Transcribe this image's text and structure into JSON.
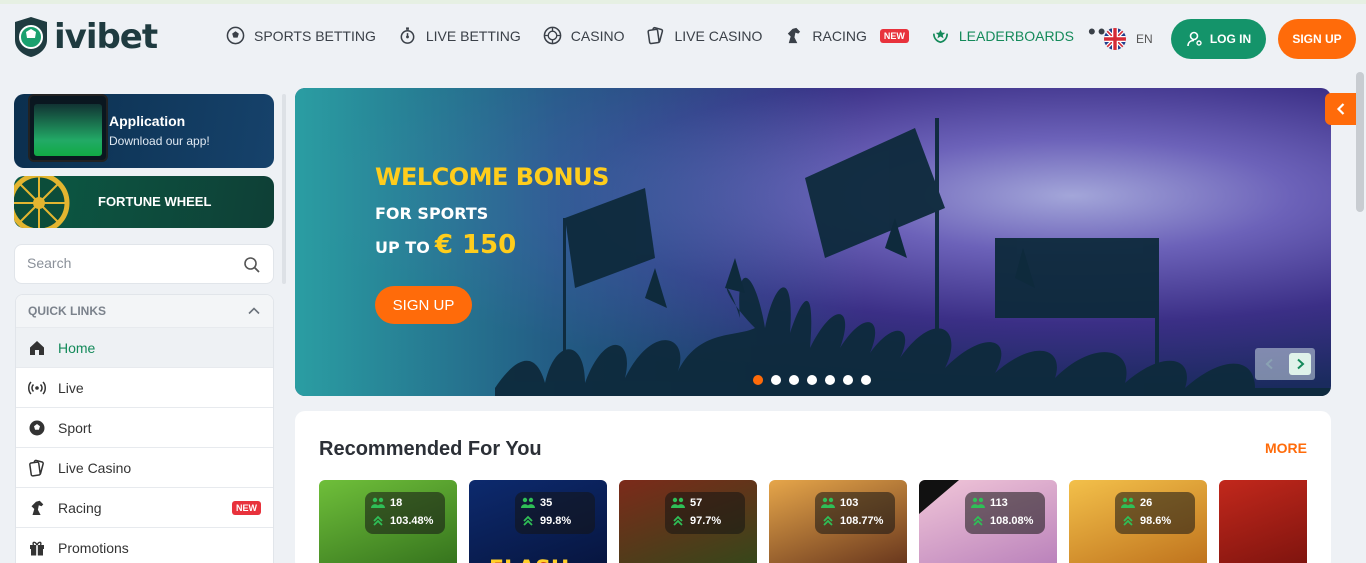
{
  "brand": {
    "name": "ivibet"
  },
  "nav": [
    {
      "label": "SPORTS BETTING",
      "icon": "soccer-ball-icon"
    },
    {
      "label": "LIVE BETTING",
      "icon": "stopwatch-icon"
    },
    {
      "label": "CASINO",
      "icon": "roulette-icon"
    },
    {
      "label": "LIVE CASINO",
      "icon": "cards-icon"
    },
    {
      "label": "RACING",
      "icon": "horse-icon",
      "badge": "NEW"
    },
    {
      "label": "LEADERBOARDS",
      "icon": "laurel-icon",
      "active": true
    }
  ],
  "header": {
    "lang": "EN",
    "login": "LOG IN",
    "signup": "SIGN UP"
  },
  "sidebar": {
    "app": {
      "title": "Application",
      "subtitle": "Download our app!"
    },
    "wheel": {
      "title": "FORTUNE WHEEL"
    },
    "search_placeholder": "Search",
    "quick_title": "QUICK LINKS",
    "items": [
      {
        "label": "Home",
        "icon": "home-icon"
      },
      {
        "label": "Live",
        "icon": "broadcast-icon"
      },
      {
        "label": "Sport",
        "icon": "soccer-ball-icon"
      },
      {
        "label": "Live Casino",
        "icon": "cards-icon"
      },
      {
        "label": "Racing",
        "icon": "horse-icon",
        "badge": "NEW"
      },
      {
        "label": "Promotions",
        "icon": "gift-icon"
      }
    ]
  },
  "banner": {
    "title": "WELCOME BONUS",
    "line1": "FOR SPORTS",
    "line2_prefix": "UP TO",
    "line2_amount": "€ 150",
    "cta": "SIGN UP",
    "slide_count": 7,
    "active_slide": 0
  },
  "recommended": {
    "title": "Recommended For You",
    "more": "MORE",
    "games": [
      {
        "players": "18",
        "rtp": "103.48%",
        "colors": [
          "#6fbf3a",
          "#2f6b1a"
        ]
      },
      {
        "players": "35",
        "rtp": "99.8%",
        "colors": [
          "#0d2a6e",
          "#06133a"
        ],
        "label": "FLASH"
      },
      {
        "players": "57",
        "rtp": "97.7%",
        "colors": [
          "#7c2a1a",
          "#2e4a1a"
        ]
      },
      {
        "players": "103",
        "rtp": "108.77%",
        "colors": [
          "#e6a64a",
          "#5a2a18"
        ]
      },
      {
        "players": "113",
        "rtp": "108.08%",
        "colors": [
          "#f1c6d8",
          "#b47ab8"
        ],
        "drops": true
      },
      {
        "players": "26",
        "rtp": "98.6%",
        "colors": [
          "#f3c04a",
          "#b96a18"
        ]
      },
      {
        "players": "",
        "rtp": "",
        "colors": [
          "#c2281c",
          "#6b0e0a"
        ]
      }
    ]
  },
  "colors": {
    "accent": "#ff6b0a",
    "brand_green": "#14946a"
  }
}
